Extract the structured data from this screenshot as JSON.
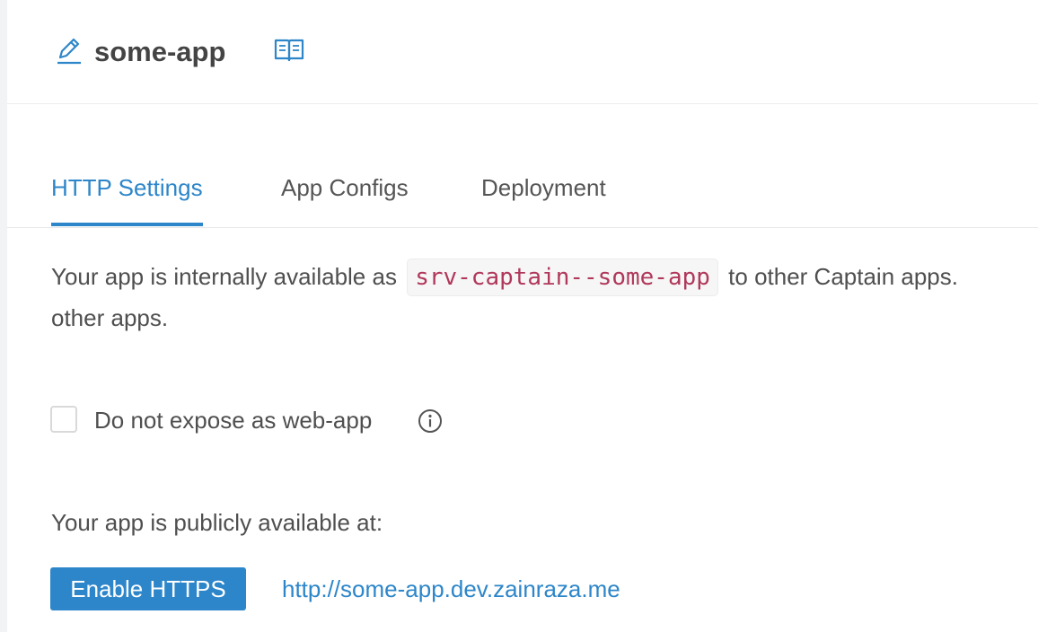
{
  "header": {
    "app_name": "some-app",
    "edit_icon": "edit-pencil-icon",
    "docs_icon": "open-book-icon"
  },
  "tabs": [
    {
      "label": "HTTP Settings",
      "active": true
    },
    {
      "label": "App Configs",
      "active": false
    },
    {
      "label": "Deployment",
      "active": false
    }
  ],
  "http_settings": {
    "internal_prefix": "Your app is internally available as",
    "internal_name": "srv-captain--some-app",
    "internal_suffix": "to other Captain apps.",
    "internal_overflow": "other apps.",
    "expose_checkbox_label": "Do not expose as web-app",
    "expose_checked": false,
    "info_icon": "info-circle-icon",
    "public_label": "Your app is publicly available at:",
    "enable_https_label": "Enable HTTPS",
    "public_url": "http://some-app.dev.zainraza.me"
  },
  "colors": {
    "accent": "#2d86c9",
    "code_text": "#b0385b",
    "body_text": "#4f4f4f"
  }
}
